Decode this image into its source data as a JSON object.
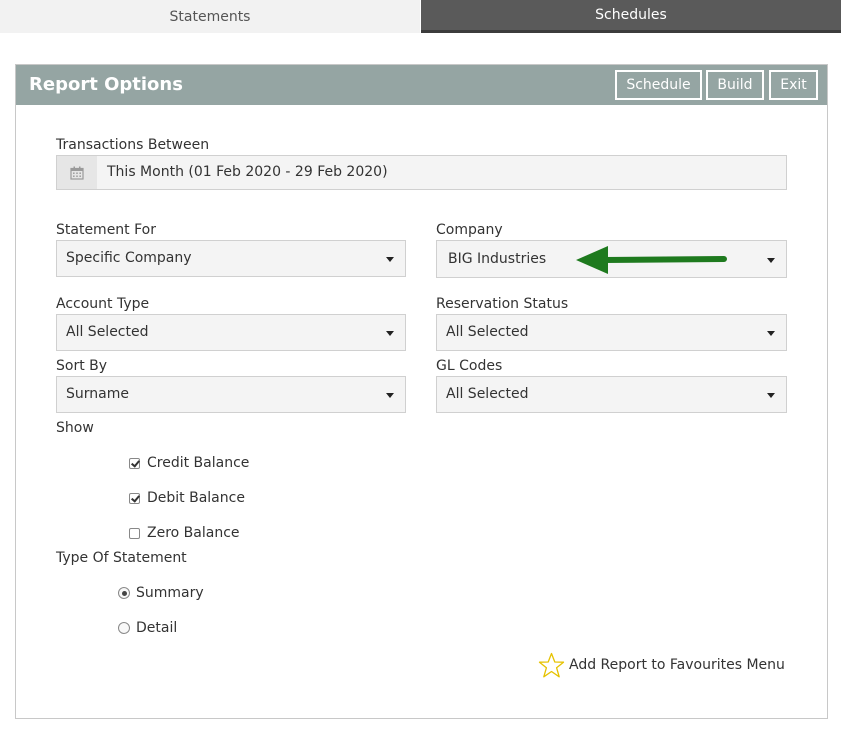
{
  "tabs": {
    "statements": "Statements",
    "schedules": "Schedules"
  },
  "panel": {
    "title": "Report Options",
    "buttons": {
      "schedule": "Schedule",
      "build": "Build",
      "exit": "Exit"
    }
  },
  "form": {
    "transactions_between": {
      "label": "Transactions Between",
      "value": "This Month (01 Feb 2020 - 29 Feb 2020)"
    },
    "statement_for": {
      "label": "Statement For",
      "value": "Specific Company"
    },
    "company": {
      "label": "Company",
      "value": "BIG Industries"
    },
    "account_type": {
      "label": "Account Type",
      "value": "All Selected"
    },
    "reservation_status": {
      "label": "Reservation Status",
      "value": "All Selected"
    },
    "sort_by": {
      "label": "Sort By",
      "value": "Surname"
    },
    "gl_codes": {
      "label": "GL Codes",
      "value": "All Selected"
    },
    "show": {
      "label": "Show",
      "options": [
        {
          "label": "Credit Balance",
          "checked": true
        },
        {
          "label": "Debit Balance",
          "checked": true
        },
        {
          "label": "Zero Balance",
          "checked": false
        }
      ]
    },
    "type_of_statement": {
      "label": "Type Of Statement",
      "options": [
        {
          "label": "Summary",
          "selected": true
        },
        {
          "label": "Detail",
          "selected": false
        }
      ]
    }
  },
  "favourites": {
    "label": "Add Report to Favourites Menu"
  },
  "colors": {
    "header_bg": "#95a5a3",
    "active_tab_bg": "#5a5a5a",
    "arrow": "#1e7a1e",
    "star": "#e6c200"
  }
}
